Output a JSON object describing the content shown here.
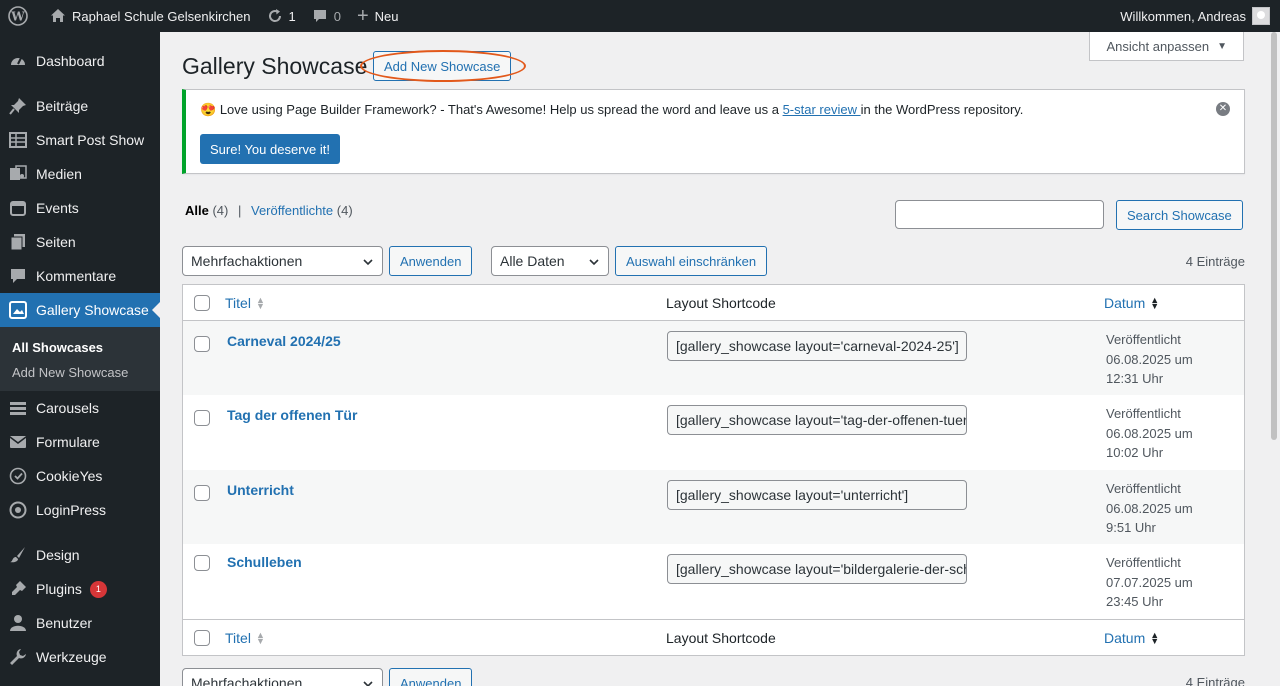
{
  "adminbar": {
    "site_name": "Raphael Schule Gelsenkirchen",
    "updates_count": "1",
    "comments_count": "0",
    "new_label": "Neu",
    "welcome": "Willkommen, Andreas"
  },
  "sidebar": {
    "items": [
      {
        "label": "Dashboard",
        "icon": "dashboard-icon"
      },
      {
        "label": "Beiträge",
        "icon": "pin-icon"
      },
      {
        "label": "Smart Post Show",
        "icon": "grid-icon"
      },
      {
        "label": "Medien",
        "icon": "media-icon"
      },
      {
        "label": "Events",
        "icon": "calendar-icon"
      },
      {
        "label": "Seiten",
        "icon": "pages-icon"
      },
      {
        "label": "Kommentare",
        "icon": "comment-icon"
      },
      {
        "label": "Gallery Showcase",
        "icon": "gallery-icon"
      },
      {
        "label": "Carousels",
        "icon": "carousel-icon"
      },
      {
        "label": "Formulare",
        "icon": "mail-icon"
      },
      {
        "label": "CookieYes",
        "icon": "cookie-icon"
      },
      {
        "label": "LoginPress",
        "icon": "loginpress-icon"
      },
      {
        "label": "Design",
        "icon": "brush-icon"
      },
      {
        "label": "Plugins",
        "icon": "plugin-icon",
        "badge": "1"
      },
      {
        "label": "Benutzer",
        "icon": "user-icon"
      },
      {
        "label": "Werkzeuge",
        "icon": "wrench-icon"
      }
    ],
    "submenu": [
      "All Showcases",
      "Add New Showcase"
    ]
  },
  "screen_options": "Ansicht anpassen",
  "page": {
    "title": "Gallery Showcase",
    "add_new": "Add New Showcase"
  },
  "notice": {
    "text_before": "Love using Page Builder Framework? - That's Awesome! Help us spread the word and leave us a ",
    "link": "5-star review ",
    "text_after": "in the WordPress repository.",
    "button": "Sure! You deserve it!"
  },
  "filters": {
    "all_label": "Alle",
    "all_count": "(4)",
    "published_label": "Veröffentlichte",
    "published_count": "(4)",
    "search_button": "Search Showcase",
    "bulk_actions": "Mehrfachaktionen",
    "apply": "Anwenden",
    "all_dates": "Alle Daten",
    "filter_button": "Auswahl einschränken",
    "count": "4 Einträge"
  },
  "table": {
    "col_title": "Titel",
    "col_shortcode": "Layout Shortcode",
    "col_date": "Datum",
    "rows": [
      {
        "title": "Carneval 2024/25",
        "shortcode": "[gallery_showcase layout='carneval-2024-25']",
        "status": "Veröffentlicht",
        "date": "06.08.2025 um",
        "time": "12:31 Uhr"
      },
      {
        "title": "Tag der offenen Tür",
        "shortcode": "[gallery_showcase layout='tag-der-offenen-tuer']",
        "status": "Veröffentlicht",
        "date": "06.08.2025 um",
        "time": "10:02 Uhr"
      },
      {
        "title": "Unterricht",
        "shortcode": "[gallery_showcase layout='unterricht']",
        "status": "Veröffentlicht",
        "date": "06.08.2025 um",
        "time": "9:51 Uhr"
      },
      {
        "title": "Schulleben",
        "shortcode": "[gallery_showcase layout='bildergalerie-der-schule']",
        "status": "Veröffentlicht",
        "date": "07.07.2025 um",
        "time": "23:45 Uhr"
      }
    ]
  },
  "colors": {
    "accent": "#2271b1",
    "sidebar_bg": "#1d2327",
    "notice_border": "#00a32a",
    "highlight_ring": "#e2591b",
    "badge": "#d63638"
  }
}
